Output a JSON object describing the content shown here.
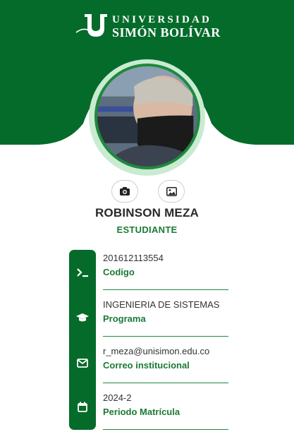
{
  "brand": {
    "line1": "UNIVERSIDAD",
    "line2": "SIMÓN BOLÍVAR",
    "script": "Simón Bolívar",
    "color": "#056b2a"
  },
  "profile": {
    "name": "ROBINSON MEZA",
    "role": "ESTUDIANTE"
  },
  "actions": {
    "camera_icon": "camera-icon",
    "gallery_icon": "image-icon"
  },
  "fields": [
    {
      "value": "201612113554",
      "label": "Codigo",
      "icon": "terminal-icon"
    },
    {
      "value": "INGENIERIA DE SISTEMAS",
      "label": "Programa",
      "icon": "graduation-cap-icon"
    },
    {
      "value": "r_meza@unisimon.edu.co",
      "label": "Correo institucional",
      "icon": "envelope-icon"
    },
    {
      "value": "2024-2",
      "label": "Periodo Matrícula",
      "icon": "calendar-icon"
    }
  ]
}
